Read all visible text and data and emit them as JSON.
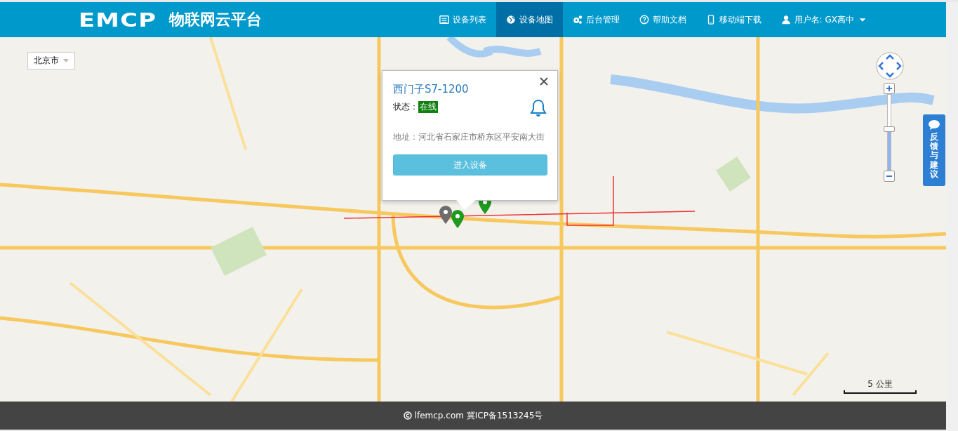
{
  "header": {
    "logo": "EMCP",
    "title": "物联网云平台",
    "nav": [
      {
        "label": "设备列表",
        "kind": "list",
        "selected": false
      },
      {
        "label": "设备地图",
        "kind": "map",
        "selected": true
      },
      {
        "label": "后台管理",
        "kind": "admin",
        "selected": false
      },
      {
        "label": "帮助文档",
        "kind": "help",
        "selected": false
      },
      {
        "label": "移动端下载",
        "kind": "mobile",
        "selected": false
      }
    ],
    "user": "用户名: GX高中"
  },
  "map": {
    "city_select": "北京市",
    "zoom": {
      "level": 0.54
    },
    "markers": [
      {
        "color": "#1e9a1e"
      },
      {
        "color": "#1e9a1e"
      },
      {
        "color": "#6d6d6d"
      }
    ],
    "popup": {
      "title": "西门子S7-1200",
      "status_label": "状态：",
      "status": "在线",
      "address": "地址：河北省石家庄市桥东区平安南大街",
      "button": "进入设备"
    },
    "feedback": "反馈与建议",
    "scale": "5 公里"
  },
  "footer": {
    "text": "lfemcp.com 冀ICP备1513245号"
  }
}
